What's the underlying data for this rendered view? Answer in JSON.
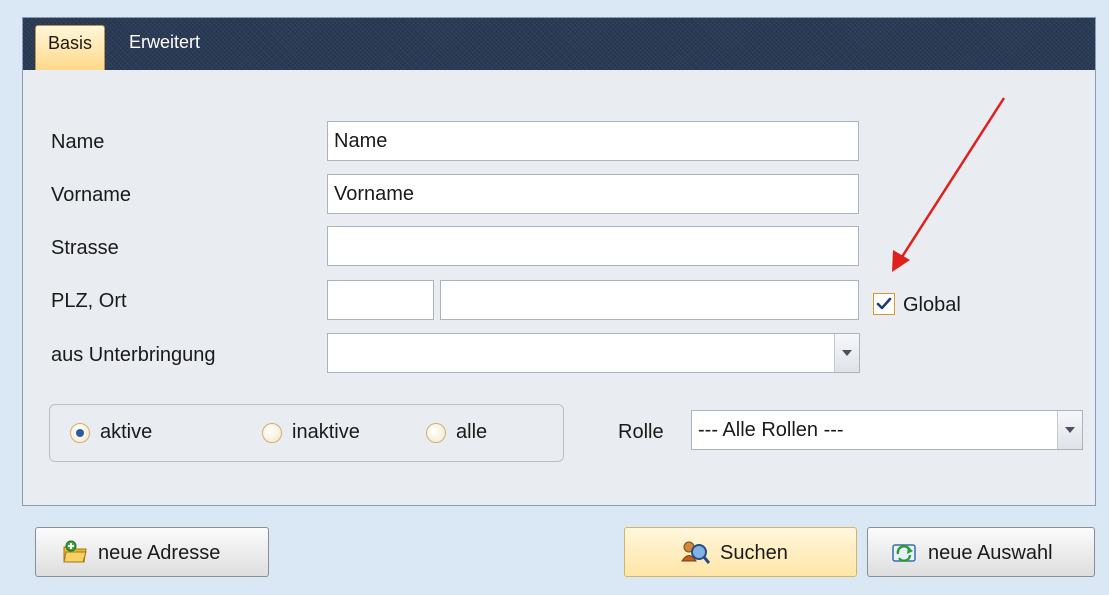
{
  "tabs": [
    {
      "label": "Basis",
      "active": true
    },
    {
      "label": "Erweitert",
      "active": false
    }
  ],
  "form": {
    "name": {
      "label": "Name",
      "value": "Name"
    },
    "vorname": {
      "label": "Vorname",
      "value": "Vorname"
    },
    "strasse": {
      "label": "Strasse",
      "value": ""
    },
    "plz_ort": {
      "label": "PLZ, Ort",
      "plz_value": "",
      "ort_value": ""
    },
    "global": {
      "label": "Global",
      "checked": true
    },
    "unterbringung": {
      "label": "aus Unterbringung",
      "value": ""
    }
  },
  "status_filter": {
    "options": [
      {
        "label": "aktive",
        "checked": true
      },
      {
        "label": "inaktive",
        "checked": false
      },
      {
        "label": "alle",
        "checked": false
      }
    ]
  },
  "rolle": {
    "label": "Rolle",
    "value": "--- Alle Rollen ---"
  },
  "buttons": {
    "neue_adresse": "neue Adresse",
    "suchen": "Suchen",
    "neue_auswahl": "neue Auswahl"
  },
  "colors": {
    "tab_bar": "#2a3a55",
    "accent_arrow": "#e0201c",
    "checkbox_border": "#d69a2a",
    "background": "#dae8f6"
  },
  "icons": {
    "neue_adresse": "folder-add-icon",
    "suchen": "people-search-icon",
    "neue_auswahl": "refresh-icon",
    "annotation": "red-arrow-annotation"
  }
}
